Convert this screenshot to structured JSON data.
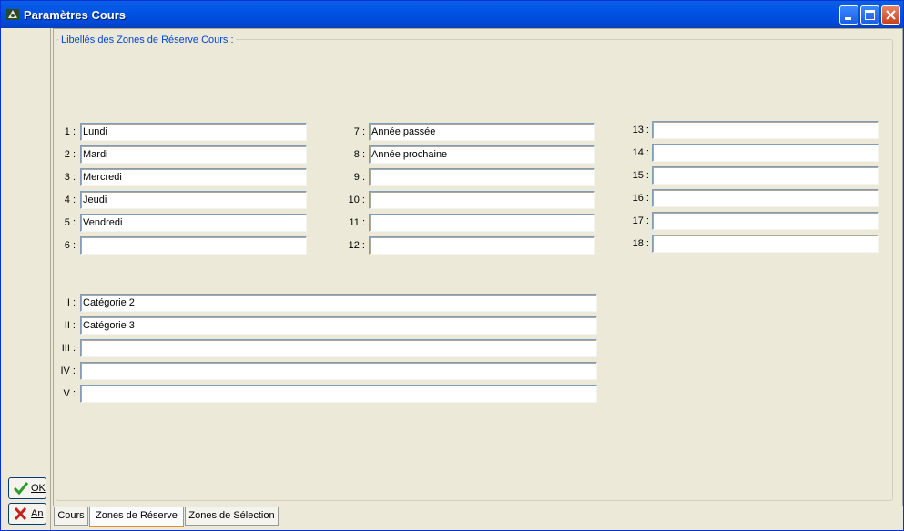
{
  "window": {
    "title": "Paramètres Cours"
  },
  "left_buttons": {
    "ok_label": "OK",
    "cancel_label": "An"
  },
  "group": {
    "title": "Libellés des Zones de Réserve Cours :"
  },
  "col1": [
    {
      "label": "1 :",
      "value": "Lundi"
    },
    {
      "label": "2 :",
      "value": "Mardi"
    },
    {
      "label": "3 :",
      "value": "Mercredi"
    },
    {
      "label": "4 :",
      "value": "Jeudi"
    },
    {
      "label": "5 :",
      "value": "Vendredi"
    },
    {
      "label": "6 :",
      "value": ""
    }
  ],
  "col2": [
    {
      "label": "7 :",
      "value": "Année passée"
    },
    {
      "label": "8 :",
      "value": "Année prochaine"
    },
    {
      "label": "9 :",
      "value": ""
    },
    {
      "label": "10 :",
      "value": ""
    },
    {
      "label": "11 :",
      "value": ""
    },
    {
      "label": "12 :",
      "value": ""
    }
  ],
  "col3": [
    {
      "label": "13 :",
      "value": ""
    },
    {
      "label": "14 :",
      "value": ""
    },
    {
      "label": "15 :",
      "value": ""
    },
    {
      "label": "16 :",
      "value": ""
    },
    {
      "label": "17 :",
      "value": ""
    },
    {
      "label": "18 :",
      "value": ""
    }
  ],
  "roman": [
    {
      "label": "I :",
      "value": "Catégorie 2"
    },
    {
      "label": "II :",
      "value": "Catégorie 3"
    },
    {
      "label": "III :",
      "value": ""
    },
    {
      "label": "IV :",
      "value": ""
    },
    {
      "label": "V :",
      "value": ""
    }
  ],
  "tabs": [
    {
      "label": "Cours"
    },
    {
      "label": "Zones de Réserve"
    },
    {
      "label": "Zones de Sélection"
    }
  ],
  "active_tab": "Zones de Réserve",
  "colors": {
    "title_bar": "#0054e3",
    "group_title": "#0046d5",
    "ok_check": "#2e9b2e",
    "cancel_x": "#c8201c"
  }
}
